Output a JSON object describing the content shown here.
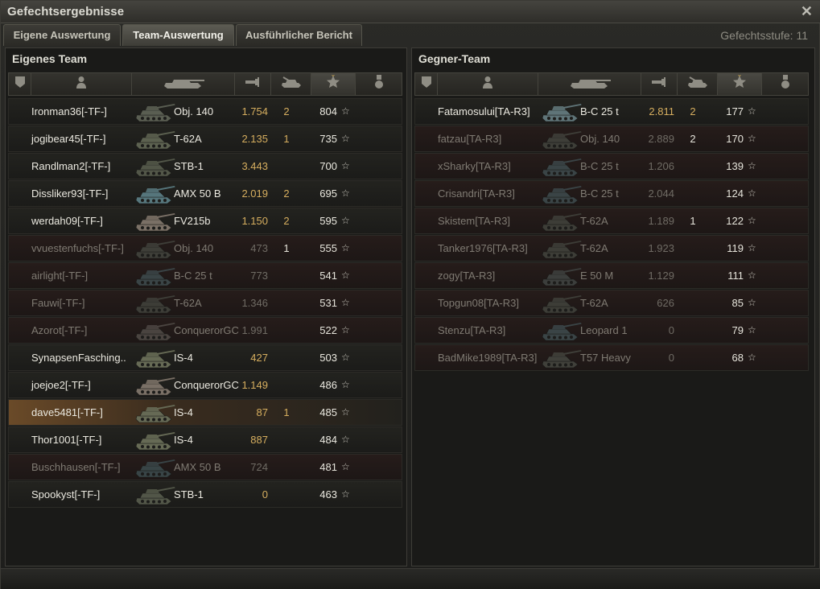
{
  "window": {
    "title": "Gefechtsergebnisse",
    "close_glyph": "✕"
  },
  "tabs": [
    {
      "label": "Eigene Auswertung",
      "active": false
    },
    {
      "label": "Team-Auswertung",
      "active": true
    },
    {
      "label": "Ausführlicher Bericht",
      "active": false
    }
  ],
  "stage": {
    "label": "Gefechtsstufe: 11"
  },
  "columns": [
    {
      "icon": "shield-icon"
    },
    {
      "icon": "player-icon"
    },
    {
      "icon": "tank-icon"
    },
    {
      "icon": "damage-icon"
    },
    {
      "icon": "kills-icon"
    },
    {
      "icon": "xp-star-icon",
      "sorted": true
    },
    {
      "icon": "medal-icon"
    }
  ],
  "colors": {
    "accent": "#d6ae5f",
    "dead_row": "#261c1a",
    "me_row": "#6a4a28"
  },
  "own_team": {
    "title": "Eigenes Team",
    "rows": [
      {
        "name": "Ironman36[-TF-]",
        "vehicle": "Obj. 140",
        "damage": "1.754",
        "kills": "2",
        "xp": "804",
        "dead": false,
        "me": false,
        "tank_color": "#5a5e52"
      },
      {
        "name": "jogibear45[-TF-]",
        "vehicle": "T-62A",
        "damage": "2.135",
        "kills": "1",
        "xp": "735",
        "dead": false,
        "me": false,
        "tank_color": "#5c6150"
      },
      {
        "name": "Randlman2[-TF-]",
        "vehicle": "STB-1",
        "damage": "3.443",
        "kills": "",
        "xp": "700",
        "dead": false,
        "me": false,
        "tank_color": "#525648"
      },
      {
        "name": "Dissliker93[-TF-]",
        "vehicle": "AMX 50 B",
        "damage": "2.019",
        "kills": "2",
        "xp": "695",
        "dead": false,
        "me": false,
        "tank_color": "#56767c"
      },
      {
        "name": "werdah09[-TF-]",
        "vehicle": "FV215b",
        "damage": "1.150",
        "kills": "2",
        "xp": "595",
        "dead": false,
        "me": false,
        "tank_color": "#7a7066"
      },
      {
        "name": "vvuestenfuchs[-TF-]",
        "vehicle": "Obj. 140",
        "damage": "473",
        "kills": "1",
        "xp": "555",
        "dead": true,
        "me": false,
        "tank_color": "#3e3e38"
      },
      {
        "name": "airlight[-TF-]",
        "vehicle": "B-C 25 t",
        "damage": "773",
        "kills": "",
        "xp": "541",
        "dead": true,
        "me": false,
        "tank_color": "#3a4446"
      },
      {
        "name": "Fauwi[-TF-]",
        "vehicle": "T-62A",
        "damage": "1.346",
        "kills": "",
        "xp": "531",
        "dead": true,
        "me": false,
        "tank_color": "#3d3d37"
      },
      {
        "name": "Azorot[-TF-]",
        "vehicle": "ConquerorGC",
        "damage": "1.991",
        "kills": "",
        "xp": "522",
        "dead": true,
        "me": false,
        "tank_color": "#4a4440"
      },
      {
        "name": "SynapsenFasching..",
        "vehicle": "IS-4",
        "damage": "427",
        "kills": "",
        "xp": "503",
        "dead": false,
        "me": false,
        "tank_color": "#666a55"
      },
      {
        "name": "joejoe2[-TF-]",
        "vehicle": "ConquerorGC",
        "damage": "1.149",
        "kills": "",
        "xp": "486",
        "dead": false,
        "me": false,
        "tank_color": "#7a7066"
      },
      {
        "name": "dave5481[-TF-]",
        "vehicle": "IS-4",
        "damage": "87",
        "kills": "1",
        "xp": "485",
        "dead": false,
        "me": true,
        "tank_color": "#666a55"
      },
      {
        "name": "Thor1001[-TF-]",
        "vehicle": "IS-4",
        "damage": "887",
        "kills": "",
        "xp": "484",
        "dead": false,
        "me": false,
        "tank_color": "#666a55"
      },
      {
        "name": "Buschhausen[-TF-]",
        "vehicle": "AMX 50 B",
        "damage": "724",
        "kills": "",
        "xp": "481",
        "dead": true,
        "me": false,
        "tank_color": "#384446"
      },
      {
        "name": "Spookyst[-TF-]",
        "vehicle": "STB-1",
        "damage": "0",
        "kills": "",
        "xp": "463",
        "dead": false,
        "me": false,
        "tank_color": "#525648"
      }
    ]
  },
  "enemy_team": {
    "title": "Gegner-Team",
    "rows": [
      {
        "name": "Fatamosului[TA-R3]",
        "vehicle": "B-C 25 t",
        "damage": "2.811",
        "kills": "2",
        "xp": "177",
        "dead": false,
        "me": false,
        "tank_color": "#5f7478"
      },
      {
        "name": "fatzau[TA-R3]",
        "vehicle": "Obj. 140",
        "damage": "2.889",
        "kills": "2",
        "xp": "170",
        "dead": true,
        "me": false,
        "tank_color": "#3e3e38"
      },
      {
        "name": "xSharky[TA-R3]",
        "vehicle": "B-C 25 t",
        "damage": "1.206",
        "kills": "",
        "xp": "139",
        "dead": true,
        "me": false,
        "tank_color": "#3a4446"
      },
      {
        "name": "Crisandri[TA-R3]",
        "vehicle": "B-C 25 t",
        "damage": "2.044",
        "kills": "",
        "xp": "124",
        "dead": true,
        "me": false,
        "tank_color": "#3a4446"
      },
      {
        "name": "Skistem[TA-R3]",
        "vehicle": "T-62A",
        "damage": "1.189",
        "kills": "1",
        "xp": "122",
        "dead": true,
        "me": false,
        "tank_color": "#3d3d37"
      },
      {
        "name": "Tanker1976[TA-R3]",
        "vehicle": "T-62A",
        "damage": "1.923",
        "kills": "",
        "xp": "119",
        "dead": true,
        "me": false,
        "tank_color": "#3d3d37"
      },
      {
        "name": "zogy[TA-R3]",
        "vehicle": "E 50 M",
        "damage": "1.129",
        "kills": "",
        "xp": "111",
        "dead": true,
        "me": false,
        "tank_color": "#3c3e3c"
      },
      {
        "name": "Topgun08[TA-R3]",
        "vehicle": "T-62A",
        "damage": "626",
        "kills": "",
        "xp": "85",
        "dead": true,
        "me": false,
        "tank_color": "#3d3d37"
      },
      {
        "name": "Stenzu[TA-R3]",
        "vehicle": "Leopard 1",
        "damage": "0",
        "kills": "",
        "xp": "79",
        "dead": true,
        "me": false,
        "tank_color": "#3a4446"
      },
      {
        "name": "BadMike1989[TA-R3]",
        "vehicle": "T57 Heavy",
        "damage": "0",
        "kills": "",
        "xp": "68",
        "dead": true,
        "me": false,
        "tank_color": "#40403a"
      }
    ]
  }
}
